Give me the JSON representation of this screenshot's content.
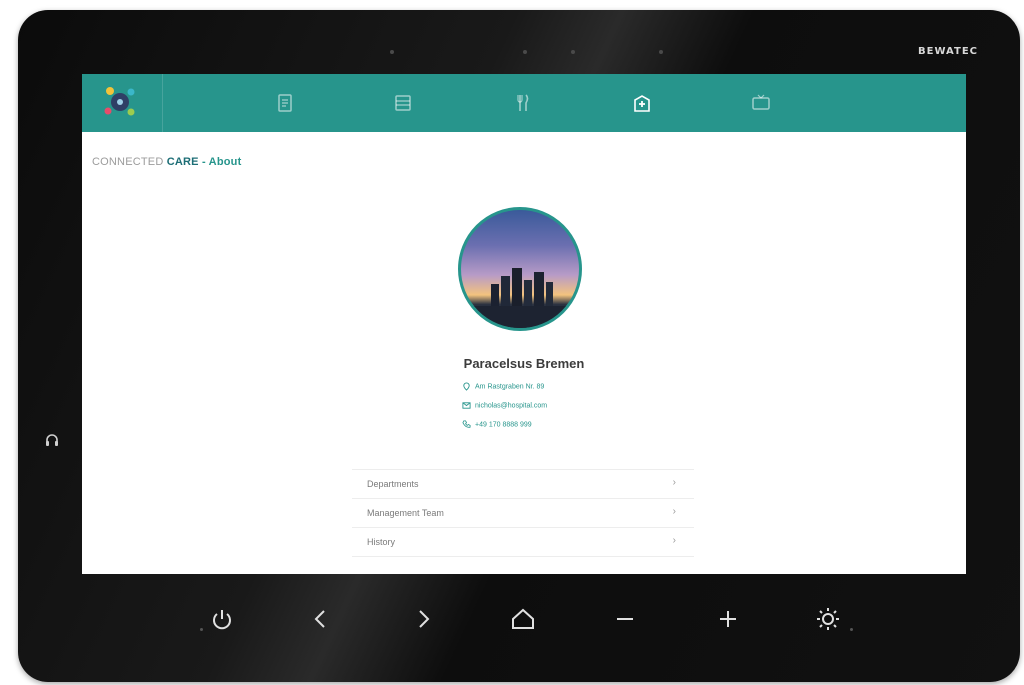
{
  "device": {
    "brand": "BEWATEC"
  },
  "nav": {
    "items": [
      {
        "icon": "page-icon",
        "active": false
      },
      {
        "icon": "document-icon",
        "active": false
      },
      {
        "icon": "cutlery-icon",
        "active": false
      },
      {
        "icon": "hospital-icon",
        "active": true
      },
      {
        "icon": "tv-icon",
        "active": false
      }
    ]
  },
  "page": {
    "title_prefix": "CONNECTED ",
    "title_brand": "CARE",
    "title_section": " - About"
  },
  "profile": {
    "name": "Paracelsus Bremen",
    "address": "Am Rastgraben Nr. 89",
    "email": "nicholas@hospital.com",
    "phone": "+49 170 8888 999"
  },
  "menu": [
    {
      "label": "Departments"
    },
    {
      "label": "Management Team"
    },
    {
      "label": "History"
    }
  ],
  "colors": {
    "accent": "#27958c",
    "bezel": "#111111"
  }
}
